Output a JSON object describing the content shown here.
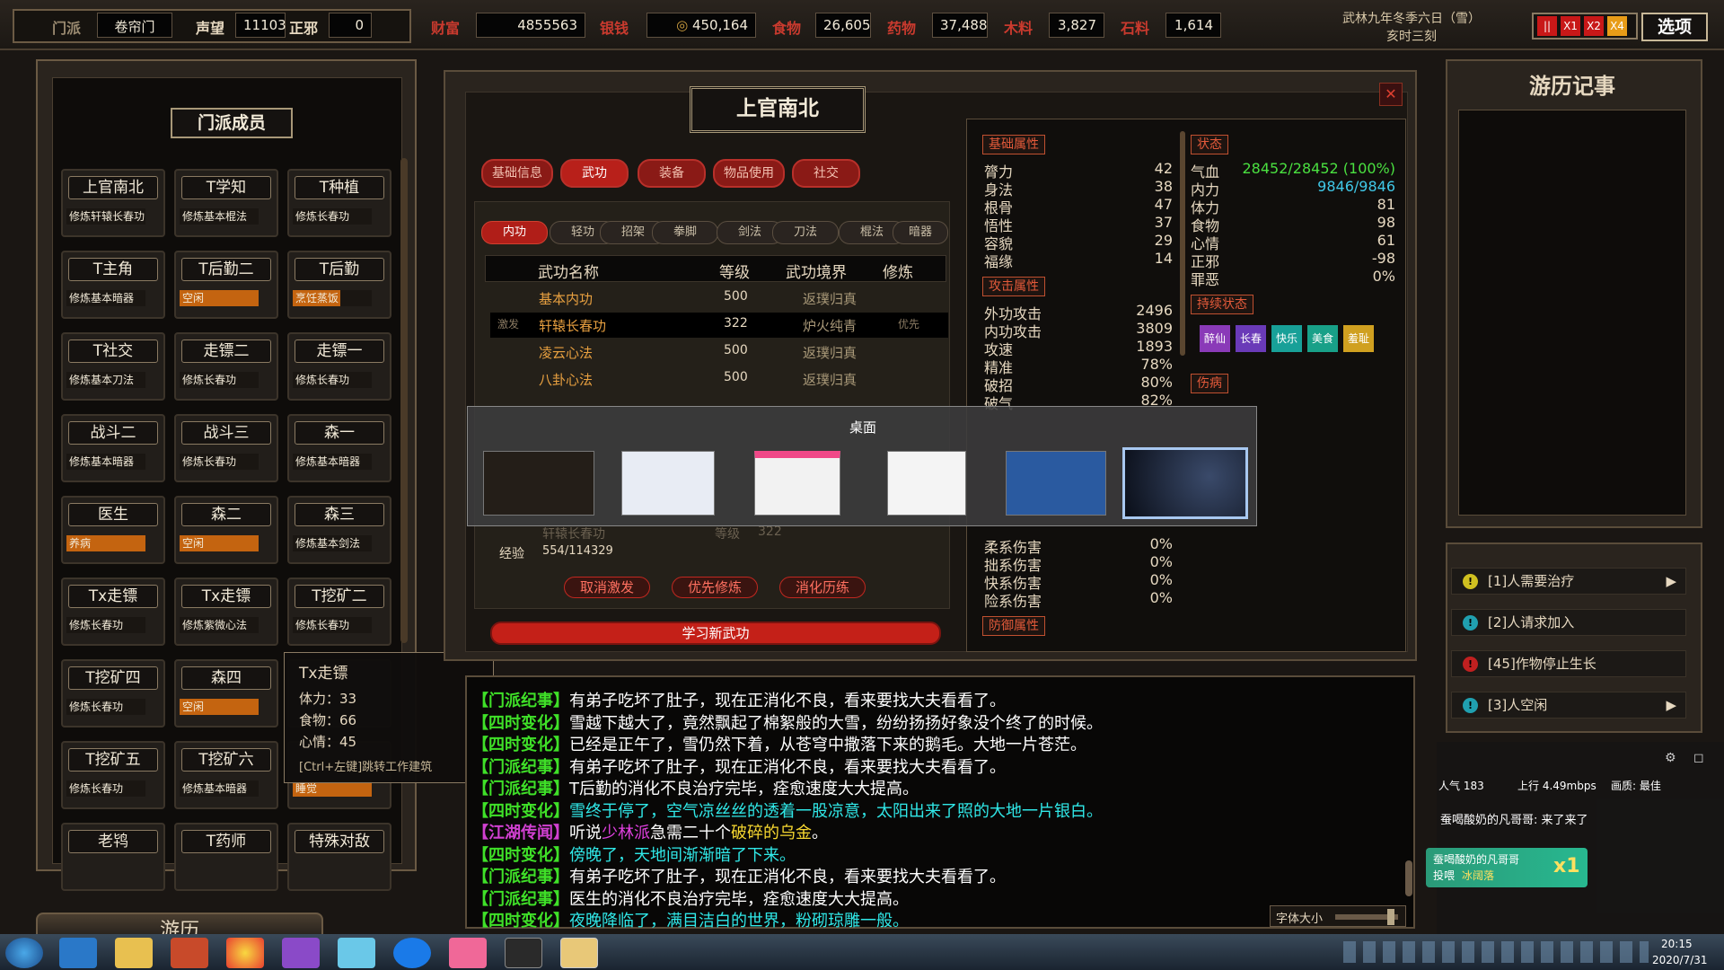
{
  "top": {
    "sect_label": "门派",
    "sect": "卷帘门",
    "fame_label": "声望",
    "fame": "11103",
    "moral_label": "正邪",
    "moral": "0",
    "wealth_label": "财富",
    "wealth": "4855563",
    "silver_label": "银钱",
    "silver": "450,164",
    "food_label": "食物",
    "food": "26,605",
    "herb_label": "药物",
    "herb": "37,488",
    "wood_label": "木料",
    "wood": "3,827",
    "stone_label": "石料",
    "stone": "1,614",
    "date": "武林九年冬季六日（雪）",
    "time": "亥时三刻",
    "speed": [
      "||",
      "X1",
      "X2",
      "X4"
    ],
    "options": "选项"
  },
  "members": {
    "title": "门派成员",
    "list": [
      {
        "name": "上官南北",
        "status": "修炼轩辕长春功",
        "style": "n"
      },
      {
        "name": "T学知",
        "status": "修炼基本棍法",
        "style": "n"
      },
      {
        "name": "T种植",
        "status": "修炼长春功",
        "style": "n"
      },
      {
        "name": "T主角",
        "status": "修炼基本暗器",
        "style": "n"
      },
      {
        "name": "T后勤二",
        "status": "空闲",
        "style": "o"
      },
      {
        "name": "T后勤",
        "status": "烹饪蒸饭",
        "style": "s"
      },
      {
        "name": "T社交",
        "status": "修炼基本刀法",
        "style": "n"
      },
      {
        "name": "走镖二",
        "status": "修炼长春功",
        "style": "n"
      },
      {
        "name": "走镖一",
        "status": "修炼长春功",
        "style": "n"
      },
      {
        "name": "战斗二",
        "status": "修炼基本暗器",
        "style": "n"
      },
      {
        "name": "战斗三",
        "status": "修炼长春功",
        "style": "n"
      },
      {
        "name": "森一",
        "status": "修炼基本暗器",
        "style": "n"
      },
      {
        "name": "医生",
        "status": "养病",
        "style": "o"
      },
      {
        "name": "森二",
        "status": "空闲",
        "style": "o"
      },
      {
        "name": "森三",
        "status": "修炼基本剑法",
        "style": "n"
      },
      {
        "name": "Tx走镖",
        "status": "修炼长春功",
        "style": "n"
      },
      {
        "name": "Tx走镖",
        "status": "修炼紫微心法",
        "style": "n"
      },
      {
        "name": "T挖矿二",
        "status": "修炼长春功",
        "style": "n"
      },
      {
        "name": "T挖矿四",
        "status": "修炼长春功",
        "style": "n"
      },
      {
        "name": "森四",
        "status": "空闲",
        "style": "o"
      },
      {
        "name": "",
        "status": "",
        "style": "n"
      },
      {
        "name": "T挖矿五",
        "status": "修炼长春功",
        "style": "n"
      },
      {
        "name": "T挖矿六",
        "status": "修炼基本暗器",
        "style": "n"
      },
      {
        "name": "",
        "status": "睡觉",
        "style": "o"
      },
      {
        "name": "老鸨",
        "status": "",
        "style": "n"
      },
      {
        "name": "T药师",
        "status": "",
        "style": "n"
      },
      {
        "name": "特殊对敌",
        "status": "",
        "style": "n"
      }
    ]
  },
  "tooltip": {
    "name": "Tx走镖",
    "hp": "体力：33",
    "food": "食物：66",
    "mood": "心情：45",
    "hint": "[Ctrl+左键]跳转工作建筑"
  },
  "travel_btn": "游历",
  "char": {
    "name": "上官南北",
    "tabs": [
      "基础信息",
      "武功",
      "装备",
      "物品使用",
      "社交"
    ],
    "subtabs": [
      "内功",
      "轻功",
      "招架",
      "拳脚",
      "剑法",
      "刀法",
      "棍法",
      "暗器"
    ],
    "headers": [
      "武功名称",
      "等级",
      "武功境界",
      "修炼"
    ],
    "skills": [
      {
        "mark": "",
        "name": "基本内功",
        "level": "500",
        "realm": "返璞归真",
        "train": ""
      },
      {
        "mark": "激发",
        "name": "轩辕长春功",
        "level": "322",
        "realm": "炉火纯青",
        "train": "优先"
      },
      {
        "mark": "",
        "name": "凌云心法",
        "level": "500",
        "realm": "返璞归真",
        "train": ""
      },
      {
        "mark": "",
        "name": "八卦心法",
        "level": "500",
        "realm": "返璞归真",
        "train": ""
      }
    ],
    "detail_skill": "轩辕长春功",
    "detail_lv_label": "等级",
    "detail_lv": "322",
    "exp_label": "经验",
    "exp": "554/114329",
    "btns": [
      "取消激发",
      "优先修炼",
      "消化历练"
    ],
    "learn": "学习新武功"
  },
  "attrs": {
    "base_title": "基础属性",
    "base": [
      [
        "膂力",
        "42"
      ],
      [
        "身法",
        "38"
      ],
      [
        "根骨",
        "47"
      ],
      [
        "悟性",
        "37"
      ],
      [
        "容貌",
        "29"
      ],
      [
        "福缘",
        "14"
      ]
    ],
    "atk_title": "攻击属性",
    "atk": [
      [
        "外功攻击",
        "2496"
      ],
      [
        "内功攻击",
        "3809"
      ],
      [
        "攻速",
        "1893"
      ],
      [
        "精准",
        "78%"
      ],
      [
        "破招",
        "80%"
      ],
      [
        "破气",
        "82%"
      ]
    ],
    "dmg": [
      [
        "柔系伤害",
        "0%"
      ],
      [
        "拙系伤害",
        "0%"
      ],
      [
        "快系伤害",
        "0%"
      ],
      [
        "险系伤害",
        "0%"
      ]
    ],
    "def_title": "防御属性",
    "state_title": "状态",
    "state": [
      [
        "气血",
        "28452/28452 (100%)"
      ],
      [
        "内力",
        "9846/9846"
      ],
      [
        "体力",
        "81"
      ],
      [
        "食物",
        "98"
      ],
      [
        "心情",
        "61"
      ],
      [
        "正邪",
        "-98"
      ],
      [
        "罪恶",
        "0%"
      ]
    ],
    "buff_title": "持续状态",
    "buffs": [
      {
        "t": "醉仙",
        "c": "#8a3ab8"
      },
      {
        "t": "长春",
        "c": "#6a3ab8"
      },
      {
        "t": "快乐",
        "c": "#18a098"
      },
      {
        "t": "美食",
        "c": "#18a088"
      },
      {
        "t": "羞耻",
        "c": "#d0a020"
      }
    ],
    "hurt_title": "伤病"
  },
  "switcher": {
    "title": "桌面"
  },
  "logs": [
    {
      "tag": "【门派纪事】",
      "text": "有弟子吃坏了肚子，现在正消化不良，看来要找大夫看看了。",
      "k": "a"
    },
    {
      "tag": "【四时变化】",
      "text": "雪越下越大了，竟然飘起了棉絮般的大雪，纷纷扬扬好象没个终了的时候。",
      "k": "a"
    },
    {
      "tag": "【四时变化】",
      "text": "已经是正午了，雪仍然下着，从苍穹中撒落下来的鹅毛。大地一片苍茫。",
      "k": "a"
    },
    {
      "tag": "【门派纪事】",
      "text": "有弟子吃坏了肚子，现在正消化不良，看来要找大夫看看了。",
      "k": "a"
    },
    {
      "tag": "【门派纪事】",
      "text": "T后勤的消化不良治疗完毕，痊愈速度大大提高。",
      "k": "a"
    },
    {
      "tag": "【四时变化】",
      "text": "雪终于停了，空气凉丝丝的透着一股凉意，太阳出来了照的大地一片银白。",
      "k": "c"
    },
    {
      "tag": "【江湖传闻】",
      "text": "听说少林派急需二十个破碎的乌金。",
      "k": "b"
    },
    {
      "tag": "【四时变化】",
      "text": "傍晚了，天地间渐渐暗了下来。",
      "k": "c"
    },
    {
      "tag": "【门派纪事】",
      "text": "有弟子吃坏了肚子，现在正消化不良，看来要找大夫看看了。",
      "k": "a"
    },
    {
      "tag": "【门派纪事】",
      "text": "医生的消化不良治疗完毕，痊愈速度大大提高。",
      "k": "a"
    },
    {
      "tag": "【四时变化】",
      "text": "夜晚降临了，满目洁白的世界，粉砌琼雕一般。",
      "k": "c"
    }
  ],
  "log_extra": {
    "b_pre": "听说",
    "b_sect": "少林派",
    "b_mid": "急需二十个",
    "b_item": "破碎的乌金",
    "b_end": "。"
  },
  "font_label": "字体大小",
  "journal": {
    "title": "游历记事"
  },
  "quests": [
    {
      "text": "[1]人需要治疗",
      "c": "#d0c020",
      "arrow": "▶"
    },
    {
      "text": "[2]人请求加入",
      "c": "#20a0b0",
      "arrow": ""
    },
    {
      "text": "[45]作物停止生长",
      "c": "#c02020",
      "arrow": ""
    },
    {
      "text": "[3]人空闲",
      "c": "#20a0b0",
      "arrow": "▶"
    }
  ],
  "stream": {
    "pop": "人气 183",
    "up": "上行 4.49mbps",
    "quality": "画质: 最佳",
    "chat1": "蚕喝酸奶的凡哥哥: 来了来了",
    "gift_user": "蚕喝酸奶的凡哥哥",
    "gift_act": "投喂",
    "gift_to": "冰阔落",
    "gift_count": "x1"
  },
  "taskbar": {
    "time": "20:15",
    "date": "2020/7/31"
  }
}
